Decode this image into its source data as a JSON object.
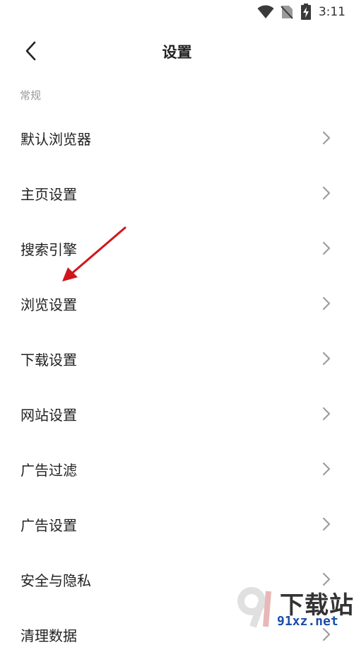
{
  "status_bar": {
    "time": "3:11"
  },
  "header": {
    "title": "设置"
  },
  "section": {
    "title": "常规"
  },
  "menu": {
    "items": [
      {
        "label": "默认浏览器"
      },
      {
        "label": "主页设置"
      },
      {
        "label": "搜索引擎"
      },
      {
        "label": "浏览设置"
      },
      {
        "label": "下载设置"
      },
      {
        "label": "网站设置"
      },
      {
        "label": "广告过滤"
      },
      {
        "label": "广告设置"
      },
      {
        "label": "安全与隐私"
      },
      {
        "label": "清理数据"
      }
    ]
  },
  "watermark": {
    "line1": "下载站",
    "line2": "91xz.net"
  },
  "colors": {
    "annotation_arrow": "#d0161b",
    "section_title": "#9a9a9a",
    "chevron": "#9e9e9e"
  }
}
